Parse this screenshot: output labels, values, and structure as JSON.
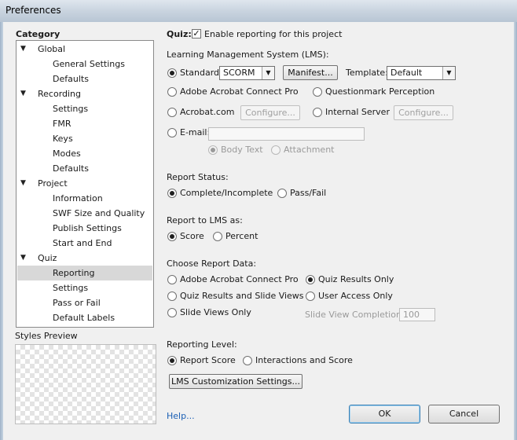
{
  "window": {
    "title": "Preferences"
  },
  "sidebar": {
    "category_label": "Category",
    "styles_preview_label": "Styles Preview",
    "items": [
      {
        "label": "Global",
        "level": 0,
        "expanded": true
      },
      {
        "label": "General Settings",
        "level": 1
      },
      {
        "label": "Defaults",
        "level": 1
      },
      {
        "label": "Recording",
        "level": 0,
        "expanded": true
      },
      {
        "label": "Settings",
        "level": 1
      },
      {
        "label": "FMR",
        "level": 1
      },
      {
        "label": "Keys",
        "level": 1
      },
      {
        "label": "Modes",
        "level": 1
      },
      {
        "label": "Defaults",
        "level": 1
      },
      {
        "label": "Project",
        "level": 0,
        "expanded": true
      },
      {
        "label": "Information",
        "level": 1
      },
      {
        "label": "SWF Size and Quality",
        "level": 1
      },
      {
        "label": "Publish Settings",
        "level": 1
      },
      {
        "label": "Start and End",
        "level": 1
      },
      {
        "label": "Quiz",
        "level": 0,
        "expanded": true
      },
      {
        "label": "Reporting",
        "level": 1,
        "selected": true
      },
      {
        "label": "Settings",
        "level": 1
      },
      {
        "label": "Pass or Fail",
        "level": 1
      },
      {
        "label": "Default Labels",
        "level": 1
      }
    ]
  },
  "quiz": {
    "label": "Quiz:",
    "enable_reporting": "Enable reporting for this project",
    "checked": true
  },
  "lms": {
    "heading": "Learning Management System (LMS):",
    "standard": "Standard:",
    "standard_value": "SCORM",
    "manifest_button": "Manifest...",
    "template": "Template:",
    "template_value": "Default",
    "adobe_connect": "Adobe Acrobat Connect Pro",
    "questionmark": "Questionmark Perception",
    "acrobat_com": "Acrobat.com",
    "configure_button": "Configure...",
    "internal_server": "Internal Server",
    "configure_button_2": "Configure...",
    "email": "E-mail:",
    "email_value": "",
    "body_text": "Body Text",
    "attachment": "Attachment",
    "selected": "Standard"
  },
  "report_status": {
    "heading": "Report Status:",
    "complete": "Complete/Incomplete",
    "pass_fail": "Pass/Fail",
    "selected": "Complete/Incomplete"
  },
  "report_to_lms": {
    "heading": "Report to LMS as:",
    "score": "Score",
    "percent": "Percent",
    "selected": "Score"
  },
  "report_data": {
    "heading": "Choose Report Data:",
    "adobe_connect": "Adobe Acrobat Connect Pro",
    "quiz_results_only": "Quiz Results Only",
    "quiz_and_slides": "Quiz Results and Slide Views",
    "user_access": "User Access Only",
    "slide_views_only": "Slide Views Only",
    "slide_view_completion": "Slide View Completion",
    "slide_view_completion_value": "100",
    "selected": "Quiz Results Only"
  },
  "reporting_level": {
    "heading": "Reporting Level:",
    "report_score": "Report Score",
    "interactions": "Interactions and Score",
    "selected": "Report Score"
  },
  "lms_customization_button": "LMS Customization Settings...",
  "footer": {
    "help": "Help...",
    "ok": "OK",
    "cancel": "Cancel"
  }
}
